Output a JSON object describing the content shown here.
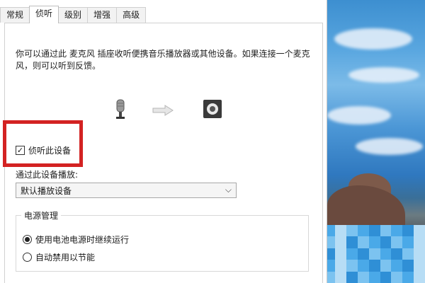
{
  "tabs": [
    {
      "label": "常规",
      "active": false
    },
    {
      "label": "侦听",
      "active": true
    },
    {
      "label": "级别",
      "active": false
    },
    {
      "label": "增强",
      "active": false
    },
    {
      "label": "高级",
      "active": false
    }
  ],
  "description": "你可以通过此 麦克风 插座收听便携音乐播放器或其他设备。如果连接一个麦克风，则可以听到反馈。",
  "icons": {
    "source": "microphone-icon",
    "arrow": "arrow-right-icon",
    "target": "speaker-icon"
  },
  "listen_checkbox": {
    "label": "侦听此设备",
    "checked": true
  },
  "highlight_color": "#d32222",
  "playback": {
    "label": "通过此设备播放:",
    "selected": "默认播放设备"
  },
  "power": {
    "title": "电源管理",
    "options": [
      {
        "label": "使用电池电源时继续运行",
        "selected": true
      },
      {
        "label": "自动禁用以节能",
        "selected": false
      }
    ]
  }
}
